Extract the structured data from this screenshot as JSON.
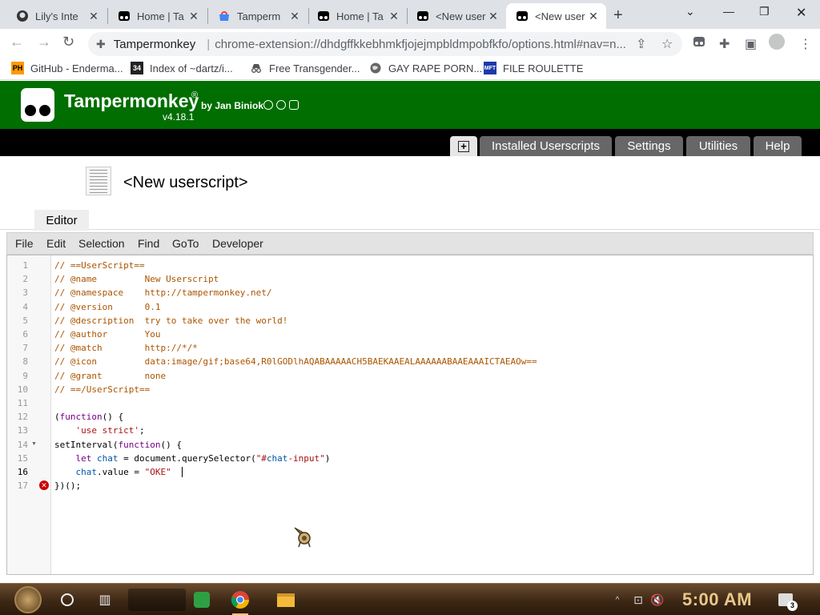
{
  "browser": {
    "tabs": [
      {
        "title": "Lily's Inte",
        "favicon": "github-icon"
      },
      {
        "title": "Home | Ta",
        "favicon": "tampermonkey-icon"
      },
      {
        "title": "Tamperm",
        "favicon": "chrome-webstore-icon"
      },
      {
        "title": "Home | Ta",
        "favicon": "tampermonkey-icon"
      },
      {
        "title": "<New user",
        "favicon": "tampermonkey-icon"
      },
      {
        "title": "<New user",
        "favicon": "tampermonkey-icon",
        "active": true
      }
    ],
    "new_tab_label": "+",
    "omnibox": {
      "site": "Tampermonkey",
      "url": "chrome-extension://dhdgffkkebhmkfjojejmpbldmpobfkfo/options.html#nav=n..."
    },
    "bookmarks": [
      {
        "label": "GitHub - Enderma...",
        "icon": "PH"
      },
      {
        "label": "Index of ~dartz/i...",
        "icon": "34"
      },
      {
        "label": "Free Transgender...",
        "icon": "incognito-icon"
      },
      {
        "label": "GAY RAPE PORN...",
        "icon": "globe-icon"
      },
      {
        "label": "FILE ROULETTE",
        "icon": "MFT"
      }
    ]
  },
  "tampermonkey": {
    "title": "Tampermonkey",
    "registered": "®",
    "by": "by Jan Biniok",
    "version": "v4.18.1",
    "nav_tabs": [
      "Installed Userscripts",
      "Settings",
      "Utilities",
      "Help"
    ],
    "script_title": "<New userscript>",
    "editor_tab": "Editor",
    "menu": [
      "File",
      "Edit",
      "Selection",
      "Find",
      "GoTo",
      "Developer"
    ]
  },
  "editor": {
    "current_line": 16,
    "error_line": 17,
    "fold_line": 14,
    "lines": [
      "// ==UserScript==",
      "// @name         New Userscript",
      "// @namespace    http://tampermonkey.net/",
      "// @version      0.1",
      "// @description  try to take over the world!",
      "// @author       You",
      "// @match        http://*/*",
      "// @icon         data:image/gif;base64,R0lGODlhAQABAAAAACH5BAEKAAEALAAAAAABAAEAAAICTAEAOw==",
      "// @grant        none",
      "// ==/UserScript==",
      "",
      "(function() {",
      "    'use strict';",
      "setInterval(function() {",
      "    let chat = document.querySelector(\"#chat-input\")",
      "    chat.value = \"OKE\"",
      "})();"
    ]
  },
  "taskbar": {
    "clock": "5:00 AM",
    "notification_count": "3"
  }
}
